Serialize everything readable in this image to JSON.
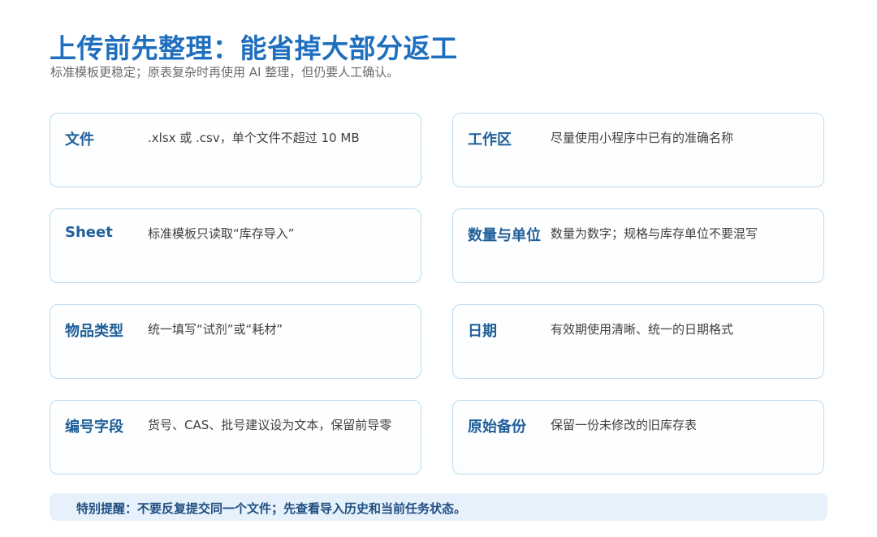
{
  "header": {
    "title": "上传前先整理：能省掉大部分返工",
    "subtitle": "标准模板更稳定；原表复杂时再使用 AI 整理，但仍要人工确认。"
  },
  "cards": [
    {
      "label": "文件",
      "value": ".xlsx 或 .csv，单个文件不超过 10 MB"
    },
    {
      "label": "工作区",
      "value": "尽量使用小程序中已有的准确名称"
    },
    {
      "label": "Sheet",
      "value": "标准模板只读取“库存导入”"
    },
    {
      "label": "数量与单位",
      "value": "数量为数字；规格与库存单位不要混写"
    },
    {
      "label": "物品类型",
      "value": "统一填写“试剂”或“耗材”"
    },
    {
      "label": "日期",
      "value": "有效期使用清晰、统一的日期格式"
    },
    {
      "label": "编号字段",
      "value": "货号、CAS、批号建议设为文本，保留前导零"
    },
    {
      "label": "原始备份",
      "value": "保留一份未修改的旧库存表"
    }
  ],
  "note": {
    "text": "特别提醒：不要反复提交同一个文件；先查看导入历史和当前任务状态。"
  }
}
